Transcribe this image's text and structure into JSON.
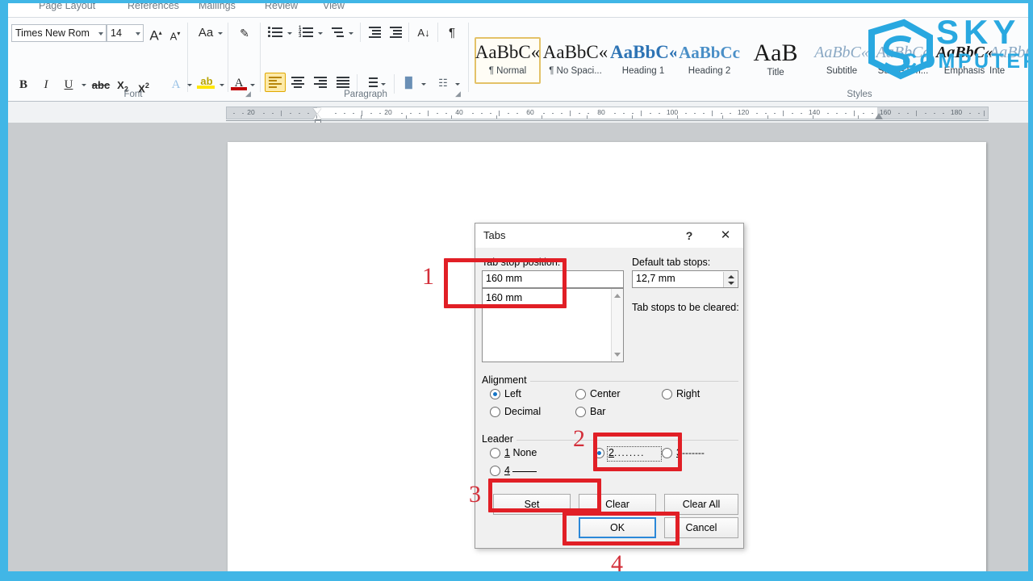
{
  "app": {
    "ribbon_tabs": [
      "Page Layout",
      "References",
      "Mailings",
      "Review",
      "View"
    ],
    "font_group": {
      "label": "Font",
      "font_name": "Times New Rom",
      "font_size": "14",
      "grow_font": "A",
      "shrink_font": "A",
      "change_case": "Aa",
      "clear_formatting": "A",
      "bold": "B",
      "italic": "I",
      "underline": "U",
      "strikethrough": "abc",
      "subscript": "X₂",
      "superscript": "X²",
      "text_effects": "A",
      "highlight": "ab",
      "font_color": "A"
    },
    "paragraph_group": {
      "label": "Paragraph"
    },
    "styles_group": {
      "label": "Styles",
      "items": [
        {
          "preview": "AaBbC«",
          "name": "¶ Normal",
          "selected": true
        },
        {
          "preview": "AaBbC«",
          "name": "¶ No Spaci...",
          "selected": false
        },
        {
          "preview": "AaBbC«",
          "name": "Heading 1",
          "selected": false
        },
        {
          "preview": "AaBbCc",
          "name": "Heading 2",
          "selected": false
        },
        {
          "preview": "AaB",
          "name": "Title",
          "selected": false
        },
        {
          "preview": "AaBbC«",
          "name": "Subtitle",
          "selected": false
        },
        {
          "preview": "AaBbCc",
          "name": "Subtle Em...",
          "selected": false
        },
        {
          "preview": "AaBbC«",
          "name": "Emphasis",
          "selected": false
        },
        {
          "preview": "AaBbC«",
          "name": "Inte",
          "selected": false
        }
      ]
    },
    "ruler": {
      "labels": [
        "20",
        "20",
        "40",
        "60",
        "80",
        "100",
        "120",
        "140",
        "160",
        "180"
      ]
    }
  },
  "watermark": {
    "line1": "SKY",
    "line2": "COMPUTER"
  },
  "dialog": {
    "title": "Tabs",
    "help_glyph": "?",
    "close_glyph": "✕",
    "tab_stop_position_label": "Tab stop position:",
    "tab_stop_position_value": "160 mm",
    "tab_stop_list": [
      "160 mm"
    ],
    "default_tab_stops_label": "Default tab stops:",
    "default_tab_stops_value": "12,7 mm",
    "tab_stops_cleared_label": "Tab stops to be cleared:",
    "alignment": {
      "caption": "Alignment",
      "options": [
        {
          "label": "Left",
          "accel": "L",
          "selected": true
        },
        {
          "label": "Center",
          "accel": "C",
          "selected": false
        },
        {
          "label": "Right",
          "accel": "R",
          "selected": false
        },
        {
          "label": "Decimal",
          "accel": "D",
          "selected": false
        },
        {
          "label": "Bar",
          "accel": "B",
          "selected": false
        }
      ]
    },
    "leader": {
      "caption": "Leader",
      "options": [
        {
          "num": "1",
          "label": "None",
          "selected": false
        },
        {
          "num": "2",
          "label": "........",
          "selected": true
        },
        {
          "num": "3",
          "label": "-------",
          "selected": false
        },
        {
          "num": "4",
          "label": "____",
          "selected": false
        }
      ]
    },
    "buttons": {
      "set": "Set",
      "clear": "Clear",
      "clear_all": "Clear All",
      "ok": "OK",
      "cancel": "Cancel"
    }
  },
  "annotations": {
    "n1": "1",
    "n2": "2",
    "n3": "3",
    "n4": "4"
  },
  "colors": {
    "frame_blue": "#41b6e6",
    "annotation_red": "#e11f26",
    "watermark_blue": "#29a8e0",
    "focus_blue": "#2b88d8"
  }
}
